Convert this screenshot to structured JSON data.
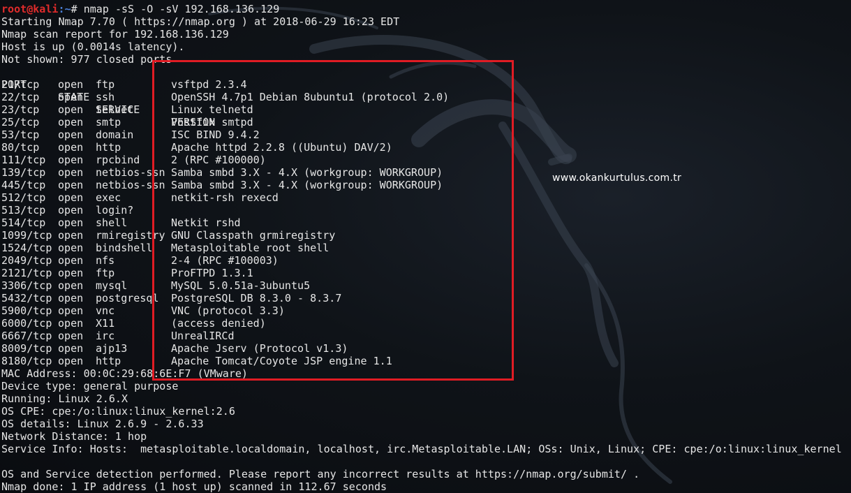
{
  "prompt": {
    "user": "root@kali",
    "path": ":~",
    "symbol": "# ",
    "command": "nmap -sS -O -sV 192.168.136.129"
  },
  "header_lines": [
    "Starting Nmap 7.70 ( https://nmap.org ) at 2018-06-29 16:23 EDT",
    "Nmap scan report for 192.168.136.129",
    "Host is up (0.0014s latency).",
    "Not shown: 977 closed ports"
  ],
  "table": {
    "headers": {
      "port": "PORT",
      "state": "STATE",
      "service": "SERVICE",
      "version": "VERSION"
    },
    "rows": [
      {
        "port": "21/tcp",
        "state": "open",
        "service": "ftp",
        "version": "vsftpd 2.3.4"
      },
      {
        "port": "22/tcp",
        "state": "open",
        "service": "ssh",
        "version": "OpenSSH 4.7p1 Debian 8ubuntu1 (protocol 2.0)"
      },
      {
        "port": "23/tcp",
        "state": "open",
        "service": "telnet",
        "version": "Linux telnetd"
      },
      {
        "port": "25/tcp",
        "state": "open",
        "service": "smtp",
        "version": "Postfix smtpd"
      },
      {
        "port": "53/tcp",
        "state": "open",
        "service": "domain",
        "version": "ISC BIND 9.4.2"
      },
      {
        "port": "80/tcp",
        "state": "open",
        "service": "http",
        "version": "Apache httpd 2.2.8 ((Ubuntu) DAV/2)"
      },
      {
        "port": "111/tcp",
        "state": "open",
        "service": "rpcbind",
        "version": "2 (RPC #100000)"
      },
      {
        "port": "139/tcp",
        "state": "open",
        "service": "netbios-ssn",
        "version": "Samba smbd 3.X - 4.X (workgroup: WORKGROUP)"
      },
      {
        "port": "445/tcp",
        "state": "open",
        "service": "netbios-ssn",
        "version": "Samba smbd 3.X - 4.X (workgroup: WORKGROUP)"
      },
      {
        "port": "512/tcp",
        "state": "open",
        "service": "exec",
        "version": "netkit-rsh rexecd"
      },
      {
        "port": "513/tcp",
        "state": "open",
        "service": "login?",
        "version": ""
      },
      {
        "port": "514/tcp",
        "state": "open",
        "service": "shell",
        "version": "Netkit rshd"
      },
      {
        "port": "1099/tcp",
        "state": "open",
        "service": "rmiregistry",
        "version": "GNU Classpath grmiregistry"
      },
      {
        "port": "1524/tcp",
        "state": "open",
        "service": "bindshell",
        "version": "Metasploitable root shell"
      },
      {
        "port": "2049/tcp",
        "state": "open",
        "service": "nfs",
        "version": "2-4 (RPC #100003)"
      },
      {
        "port": "2121/tcp",
        "state": "open",
        "service": "ftp",
        "version": "ProFTPD 1.3.1"
      },
      {
        "port": "3306/tcp",
        "state": "open",
        "service": "mysql",
        "version": "MySQL 5.0.51a-3ubuntu5"
      },
      {
        "port": "5432/tcp",
        "state": "open",
        "service": "postgresql",
        "version": "PostgreSQL DB 8.3.0 - 8.3.7"
      },
      {
        "port": "5900/tcp",
        "state": "open",
        "service": "vnc",
        "version": "VNC (protocol 3.3)"
      },
      {
        "port": "6000/tcp",
        "state": "open",
        "service": "X11",
        "version": "(access denied)"
      },
      {
        "port": "6667/tcp",
        "state": "open",
        "service": "irc",
        "version": "UnrealIRCd"
      },
      {
        "port": "8009/tcp",
        "state": "open",
        "service": "ajp13",
        "version": "Apache Jserv (Protocol v1.3)"
      },
      {
        "port": "8180/tcp",
        "state": "open",
        "service": "http",
        "version": "Apache Tomcat/Coyote JSP engine 1.1"
      }
    ]
  },
  "footer_lines": [
    "MAC Address: 00:0C:29:68:6E:F7 (VMware)",
    "Device type: general purpose",
    "Running: Linux 2.6.X",
    "OS CPE: cpe:/o:linux:linux_kernel:2.6",
    "OS details: Linux 2.6.9 - 2.6.33",
    "Network Distance: 1 hop",
    "Service Info: Hosts:  metasploitable.localdomain, localhost, irc.Metasploitable.LAN; OSs: Unix, Linux; CPE: cpe:/o:linux:linux_kernel",
    "",
    "OS and Service detection performed. Please report any incorrect results at https://nmap.org/submit/ .",
    "Nmap done: 1 IP address (1 host up) scanned in 112.67 seconds"
  ],
  "watermark": "www.okankurtulus.com.tr",
  "colors": {
    "background": "#0b0e13",
    "text": "#e6e6e6",
    "prompt_user": "#e02b2b",
    "prompt_path": "#4b7fd6",
    "highlight_border": "#e01c24"
  },
  "icons": {
    "wallpaper": "kali-dragon-icon"
  }
}
